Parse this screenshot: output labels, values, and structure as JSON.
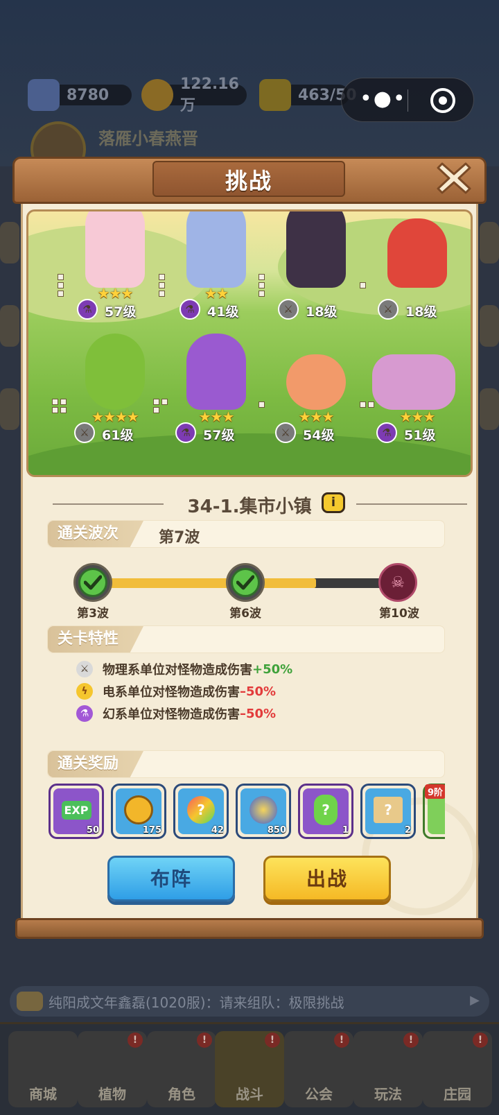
{
  "resources": [
    {
      "name": "gem",
      "value": "8780",
      "color": "#6a86c8"
    },
    {
      "name": "coin",
      "value": "122.16万",
      "color": "#c99a2e"
    },
    {
      "name": "energy",
      "value": "463/50",
      "color": "#c9a62e"
    }
  ],
  "player": {
    "name": "落雁小春燕晋"
  },
  "modal": {
    "title": "挑战",
    "stage_title": "34-1.集市小镇",
    "units_row1": [
      {
        "name": "pink-flower-girl",
        "level": "57级",
        "stars": "★★★",
        "type": "potion",
        "color": "#f7c9d6"
      },
      {
        "name": "blue-flower-girl",
        "level": "41级",
        "stars": "★★",
        "type": "potion",
        "color": "#9fb4e6"
      },
      {
        "name": "dark-bat-cat",
        "level": "18级",
        "stars": "",
        "type": "weapon",
        "color": "#3e3146"
      },
      {
        "name": "tomato-warrior",
        "level": "18级",
        "stars": "",
        "type": "weapon",
        "color": "#e0463a"
      }
    ],
    "units_row2": [
      {
        "name": "green-melon-brute",
        "level": "61级",
        "stars": "★★★★",
        "type": "weapon",
        "color": "#7fbf3a"
      },
      {
        "name": "purple-witch",
        "level": "57级",
        "stars": "★★★",
        "type": "potion",
        "color": "#9a5ad0"
      },
      {
        "name": "peach-knight",
        "level": "54级",
        "stars": "★★★",
        "type": "weapon",
        "color": "#f29a6a"
      },
      {
        "name": "golden-crab-king",
        "level": "51级",
        "stars": "★★★",
        "type": "potion",
        "color": "#d79ad0"
      }
    ],
    "clear_wave": {
      "label": "通关波次",
      "value": "第7波"
    },
    "waves": {
      "labels": [
        "第3波",
        "第6波",
        "第10波"
      ],
      "progress": 0.74
    },
    "traits": {
      "label": "关卡特性",
      "items": [
        {
          "text": "物理系单位对怪物造成伤害",
          "value": "+50%",
          "icon": "sword-icon",
          "kind": "pos"
        },
        {
          "text": "电系单位对怪物造成伤害",
          "value": "–50%",
          "icon": "lightning-icon",
          "kind": "neg"
        },
        {
          "text": "幻系单位对怪物造成伤害",
          "value": "–50%",
          "icon": "potion-icon",
          "kind": "neg"
        }
      ]
    },
    "rewards": {
      "label": "通关奖励",
      "items": [
        {
          "name": "exp",
          "glyph": "EXP",
          "count": "50",
          "bg": "#8c55c9",
          "border": "#5b2f8a"
        },
        {
          "name": "gold-coin",
          "glyph": "◎",
          "count": "175",
          "bg": "#49a9e3",
          "border": "#2b5f92"
        },
        {
          "name": "mystery-seed",
          "glyph": "?",
          "count": "42",
          "bg": "#49a9e3",
          "border": "#2b5f92"
        },
        {
          "name": "blue-flame-orb",
          "glyph": "◉",
          "count": "850",
          "bg": "#49a9e3",
          "border": "#2b5f92"
        },
        {
          "name": "mystery-potion",
          "glyph": "?",
          "count": "1",
          "bg": "#8c55c9",
          "border": "#5b2f8a"
        },
        {
          "name": "mystery-scroll",
          "glyph": "?",
          "count": "2",
          "bg": "#49a9e3",
          "border": "#2b5f92"
        },
        {
          "name": "tier-item",
          "glyph": "",
          "count": "",
          "tag": "9阶",
          "bg": "#7fcf5a",
          "border": "#3f7a2a"
        }
      ]
    },
    "buttons": {
      "formation": "布阵",
      "battle": "出战"
    }
  },
  "chat": {
    "text": "纯阳成文年鑫磊(1020服)：请来组队：极限挑战"
  },
  "nav": [
    {
      "label": "商城",
      "badge": ""
    },
    {
      "label": "植物",
      "badge": "!"
    },
    {
      "label": "角色",
      "badge": "!"
    },
    {
      "label": "战斗",
      "badge": "!"
    },
    {
      "label": "公会",
      "badge": "!"
    },
    {
      "label": "玩法",
      "badge": "!"
    },
    {
      "label": "庄园",
      "badge": "!"
    }
  ]
}
